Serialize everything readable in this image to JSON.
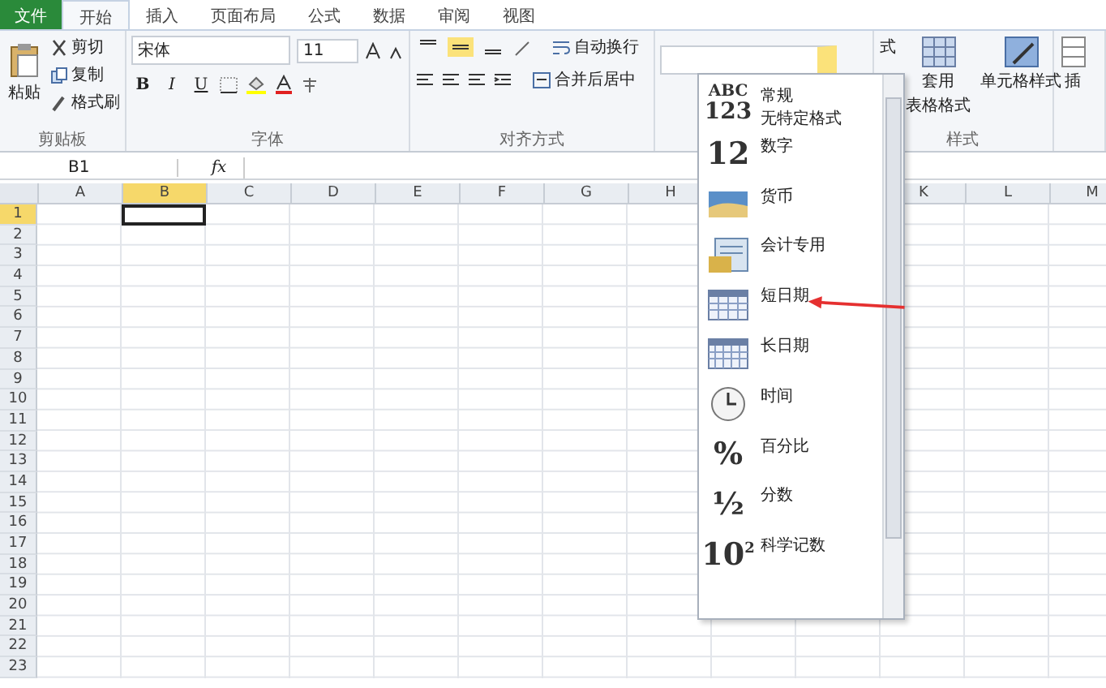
{
  "file_tab": {
    "label": "文件"
  },
  "tabs": [
    {
      "label": "开始",
      "selected": true
    },
    {
      "label": "插入",
      "selected": false
    },
    {
      "label": "页面布局",
      "selected": false
    },
    {
      "label": "公式",
      "selected": false
    },
    {
      "label": "数据",
      "selected": false
    },
    {
      "label": "审阅",
      "selected": false
    },
    {
      "label": "视图",
      "selected": false
    }
  ],
  "clipboard": {
    "paste": "粘贴",
    "cut": "剪切",
    "copy": "复制",
    "format_painter": "格式刷",
    "label": "剪贴板"
  },
  "font": {
    "name": "宋体",
    "size": "11",
    "bold": "B",
    "italic": "I",
    "underline": "U",
    "label": "字体"
  },
  "alignment": {
    "buttons": [
      {
        "kind": "top",
        "selected": false
      },
      {
        "kind": "middle",
        "selected": true
      },
      {
        "kind": "bottom",
        "selected": false
      }
    ],
    "wrap": "自动换行",
    "merge": "合并后居中",
    "label": "对齐方式"
  },
  "styles": {
    "conditional": "式",
    "table_format": "套用",
    "table_format_2": "表格格式",
    "cell_styles": "单元格样式",
    "label": "样式"
  },
  "cells": {
    "insert": "插"
  },
  "formula_bar": {
    "name_box": "B1",
    "fx": "fx"
  },
  "sheet": {
    "columns": [
      {
        "label": "A",
        "selected": false
      },
      {
        "label": "B",
        "selected": true
      },
      {
        "label": "C",
        "selected": false
      },
      {
        "label": "D",
        "selected": false
      },
      {
        "label": "E",
        "selected": false
      },
      {
        "label": "F",
        "selected": false
      },
      {
        "label": "G",
        "selected": false
      },
      {
        "label": "H",
        "selected": false
      }
    ],
    "columns_right": [
      {
        "label": "K",
        "selected": false
      },
      {
        "label": "L",
        "selected": false
      },
      {
        "label": "M",
        "selected": false
      }
    ],
    "rows": [
      {
        "label": "1",
        "selected": true
      },
      {
        "label": "2",
        "selected": false
      },
      {
        "label": "3",
        "selected": false
      },
      {
        "label": "4",
        "selected": false
      },
      {
        "label": "5",
        "selected": false
      },
      {
        "label": "6",
        "selected": false
      },
      {
        "label": "7",
        "selected": false
      },
      {
        "label": "8",
        "selected": false
      },
      {
        "label": "9",
        "selected": false
      },
      {
        "label": "10",
        "selected": false
      },
      {
        "label": "11",
        "selected": false
      },
      {
        "label": "12",
        "selected": false
      },
      {
        "label": "13",
        "selected": false
      },
      {
        "label": "14",
        "selected": false
      },
      {
        "label": "15",
        "selected": false
      },
      {
        "label": "16",
        "selected": false
      },
      {
        "label": "17",
        "selected": false
      },
      {
        "label": "18",
        "selected": false
      },
      {
        "label": "19",
        "selected": false
      },
      {
        "label": "20",
        "selected": false
      },
      {
        "label": "21",
        "selected": false
      },
      {
        "label": "22",
        "selected": false
      },
      {
        "label": "23",
        "selected": false
      }
    ]
  },
  "format_menu": {
    "items": [
      {
        "kind": "general",
        "glyph": "ABC",
        "glyph_2": "123",
        "label": "常规",
        "sublabel": "无特定格式"
      },
      {
        "kind": "number",
        "glyph": "12",
        "label": "数字"
      },
      {
        "kind": "currency",
        "label": "货币"
      },
      {
        "kind": "accounting",
        "label": "会计专用"
      },
      {
        "kind": "short-date",
        "label": "短日期"
      },
      {
        "kind": "long-date",
        "label": "长日期"
      },
      {
        "kind": "time",
        "label": "时间"
      },
      {
        "kind": "percent",
        "glyph": "%",
        "label": "百分比"
      },
      {
        "kind": "fraction",
        "glyph": "½",
        "label": "分数"
      },
      {
        "kind": "scientific",
        "glyph": "10",
        "glyph_sup": "2",
        "label": "科学记数"
      }
    ]
  }
}
